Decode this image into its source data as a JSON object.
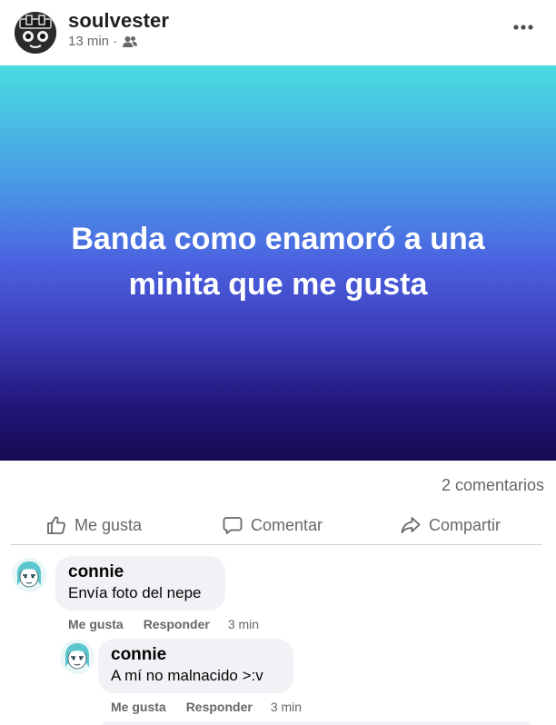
{
  "post": {
    "author": "soulvester",
    "time": "13 min ·",
    "audience_icon": "friends-icon",
    "more_icon": "more-dots-icon",
    "banner_text": "Banda como enamoró a una minita que me gusta",
    "banner_colors": [
      "#48dde0",
      "#4b62e0",
      "#160a52"
    ],
    "comment_count": "2 comentarios"
  },
  "actions": {
    "like": "Me gusta",
    "comment": "Comentar",
    "share": "Compartir"
  },
  "comments": [
    {
      "name": "connie",
      "text": "Envía foto del nepe",
      "like": "Me gusta",
      "reply": "Responder",
      "time": "3 min"
    },
    {
      "name": "connie",
      "text": "A mí no malnacido >:v",
      "like": "Me gusta",
      "reply": "Responder",
      "time": "3 min"
    }
  ]
}
